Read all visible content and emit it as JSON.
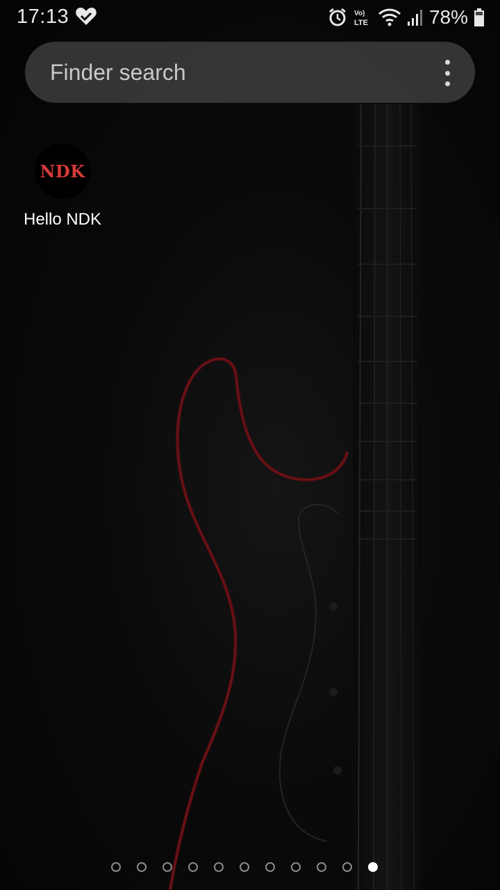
{
  "status_bar": {
    "time": "17:13",
    "battery_percent": "78%",
    "network_type": "Vo) LTE",
    "icons": [
      "heart-check-icon",
      "alarm-icon",
      "volte-icon",
      "wifi-icon",
      "signal-icon",
      "battery-icon"
    ]
  },
  "search": {
    "placeholder": "Finder search",
    "menu_icon": "more-vertical-icon"
  },
  "apps": [
    {
      "icon_text": "NDK",
      "label": "Hello NDK"
    }
  ],
  "page_indicator": {
    "total_pages": 11,
    "current_page": 11
  },
  "colors": {
    "accent_red": "#d63a3a",
    "background": "#050505"
  }
}
